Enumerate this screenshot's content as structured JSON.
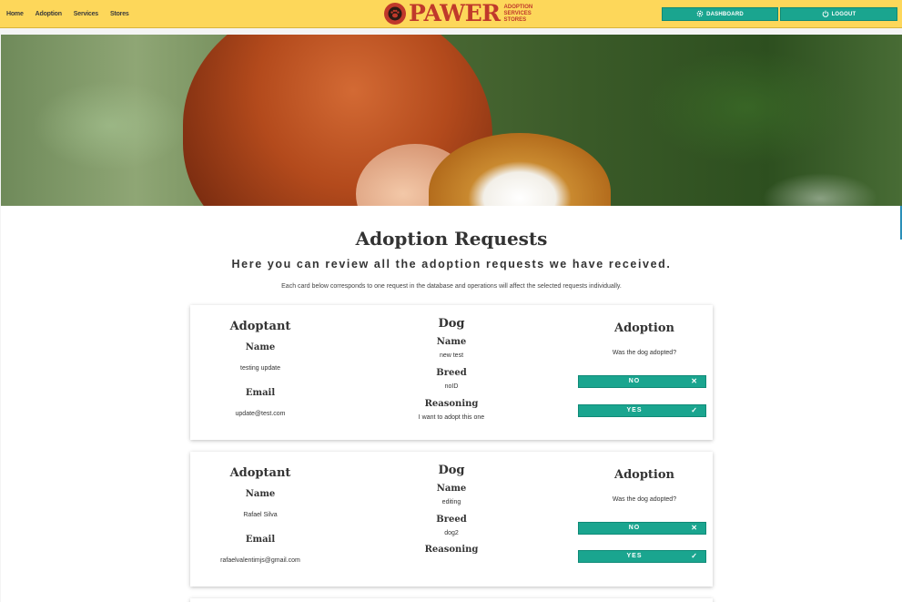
{
  "nav": {
    "links": [
      "Home",
      "Adoption",
      "Services",
      "Stores"
    ],
    "logo_text": "PAWER",
    "logo_sub": [
      "ADOPTION",
      "SERVICES",
      "STORES"
    ],
    "dashboard_label": "DASHBOARD",
    "logout_label": "LOGOUT"
  },
  "page": {
    "title": "Adoption Requests",
    "subtitle": "Here you can review all the adoption requests we have received.",
    "note": "Each card below corresponds to one request in the database and operations will affect the selected requests individually."
  },
  "labels": {
    "adoptant": "Adoptant",
    "dog": "Dog",
    "adoption": "Adoption",
    "name": "Name",
    "email": "Email",
    "breed": "Breed",
    "reasoning": "Reasoning",
    "question": "Was the dog adopted?",
    "no": "NO",
    "yes": "YES"
  },
  "requests": [
    {
      "adoptant_name": "testing update",
      "adoptant_email": "update@test.com",
      "dog_name": "new test",
      "dog_breed": "noID",
      "reasoning": "I want to adopt this one"
    },
    {
      "adoptant_name": "Rafael Silva",
      "adoptant_email": "rafaelvalentimjs@gmail.com",
      "dog_name": "editing",
      "dog_breed": "dog2",
      "reasoning": ""
    }
  ],
  "colors": {
    "navbar": "#fdd75a",
    "accent": "#1aa58f",
    "brand": "#c0392b"
  },
  "icons": [
    "gear-icon",
    "power-icon",
    "close-icon",
    "check-icon",
    "paw-icon"
  ]
}
